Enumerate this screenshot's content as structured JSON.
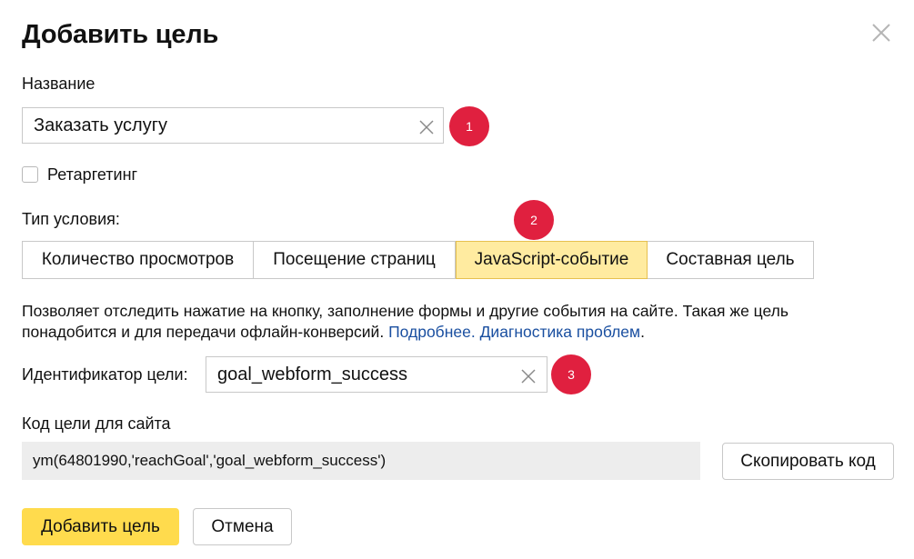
{
  "dialog": {
    "title": "Добавить цель"
  },
  "name_field": {
    "label": "Название",
    "value": "Заказать услугу"
  },
  "retargeting": {
    "label": "Ретаргетинг",
    "checked": false
  },
  "condition": {
    "label": "Тип условия:",
    "tabs": [
      {
        "label": "Количество просмотров",
        "active": false
      },
      {
        "label": "Посещение страниц",
        "active": false
      },
      {
        "label": "JavaScript-событие",
        "active": true
      },
      {
        "label": "Составная цель",
        "active": false
      }
    ]
  },
  "description": {
    "text": "Позволяет отследить нажатие на кнопку, заполнение формы и другие события на сайте. Такая же цель понадобится и для передачи офлайн-конверсий.",
    "link_more": "Подробнее.",
    "link_diagnostics": "Диагностика проблем",
    "trailing": "."
  },
  "goal_id": {
    "label": "Идентификатор цели:",
    "value": "goal_webform_success"
  },
  "site_code": {
    "label": "Код цели для сайта",
    "code": "ym(64801990,'reachGoal','goal_webform_success')",
    "copy_label": "Скопировать код"
  },
  "actions": {
    "submit_label": "Добавить цель",
    "cancel_label": "Отмена"
  },
  "markers": [
    "1",
    "2",
    "3"
  ],
  "colors": {
    "marker": "#e0203f",
    "active_tab": "#ffeba0",
    "primary_button": "#ffdb4d",
    "link": "#1a4fa0"
  },
  "icons": {
    "close": "close-icon",
    "clear": "clear-icon"
  }
}
